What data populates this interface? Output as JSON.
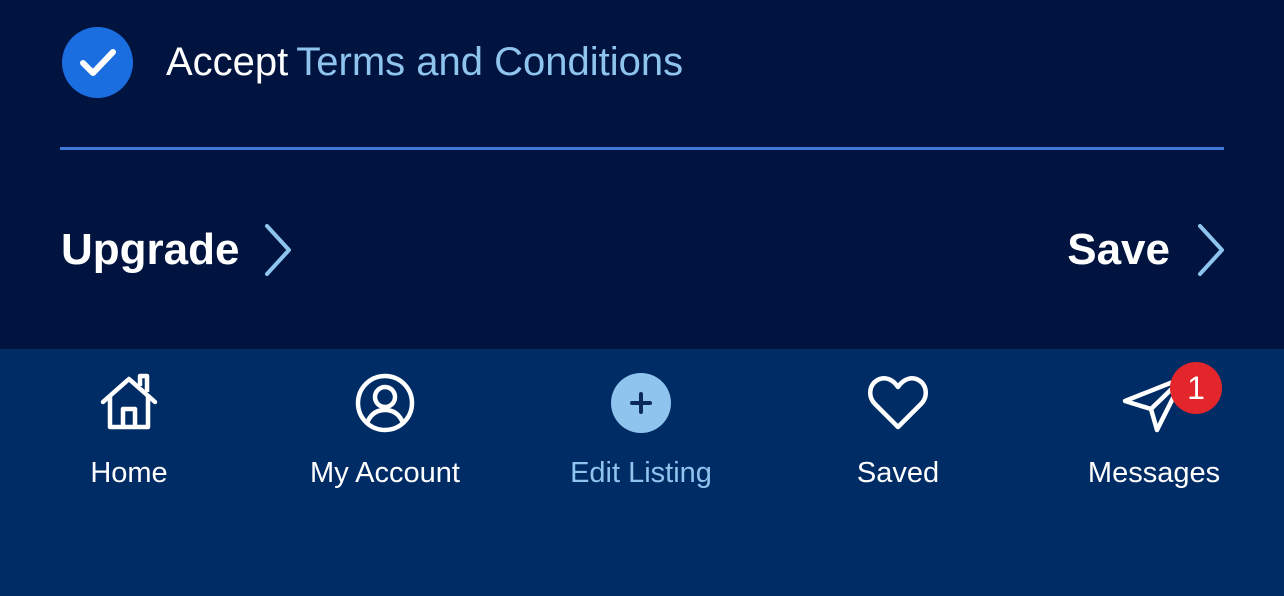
{
  "terms": {
    "checked": true,
    "accept_label": "Accept",
    "link_label": "Terms and Conditions"
  },
  "actions": {
    "upgrade_label": "Upgrade",
    "save_label": "Save"
  },
  "tab_bar": {
    "tabs": [
      {
        "label": "Home",
        "icon": "home-icon"
      },
      {
        "label": "My Account",
        "icon": "account-icon"
      },
      {
        "label": "Edit Listing",
        "icon": "plus-circle-icon",
        "active": true
      },
      {
        "label": "Saved",
        "icon": "heart-icon"
      },
      {
        "label": "Messages",
        "icon": "paper-plane-icon",
        "badge": "1"
      }
    ]
  },
  "colors": {
    "background": "#011440",
    "tab_bar_background": "#002c66",
    "accent": "#8ec4ee",
    "checkbox": "#1a6ee0",
    "divider": "#3f78d6",
    "badge": "#e3262b",
    "text": "#ffffff"
  }
}
